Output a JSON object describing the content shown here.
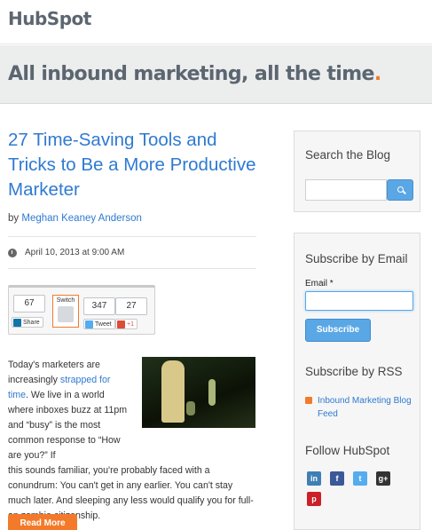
{
  "header": {
    "logo_text": "HubSpot",
    "tagline": "All inbound marketing, all the time",
    "tagline_dot": "."
  },
  "article": {
    "title": "27 Time-Saving Tools and Tricks to Be a More Productive Marketer",
    "byline_prefix": "by",
    "author": "Meghan Keaney Anderson",
    "date": "April 10, 2013 at 9:00 AM",
    "share": {
      "linkedin_count": "67",
      "linkedin_label": "Share",
      "switch_label": "Switch",
      "tweet_count": "347",
      "tweet_label": "Tweet",
      "gplus_count": "27",
      "gplus_label": "+1"
    },
    "body_part1": "Today's marketers are increasingly ",
    "body_link": "strapped for time",
    "body_part2": ". We live in a world where inboxes buzz at 11pm and “busy” is the most common response to “How are you?” If",
    "body_part3": "this sounds familiar, you're probably faced with a conundrum: You can't get in any earlier. You can't stay much later. And sleeping any less would qualify you for full-on zombie citizenship.",
    "read_more": "Read More"
  },
  "sidebar": {
    "search": {
      "title": "Search the Blog",
      "placeholder": ""
    },
    "email": {
      "title": "Subscribe by Email",
      "label": "Email *",
      "button": "Subscribe"
    },
    "rss": {
      "title": "Subscribe by RSS",
      "link": "Inbound Marketing Blog Feed"
    },
    "follow": {
      "title": "Follow HubSpot",
      "linkedin": "in",
      "facebook": "f",
      "twitter": "t",
      "gplus": "g+",
      "pinterest": "p"
    }
  },
  "colors": {
    "accent_orange": "#f37a2a",
    "link_blue": "#2f7ad1",
    "button_blue": "#5aa7e6"
  }
}
